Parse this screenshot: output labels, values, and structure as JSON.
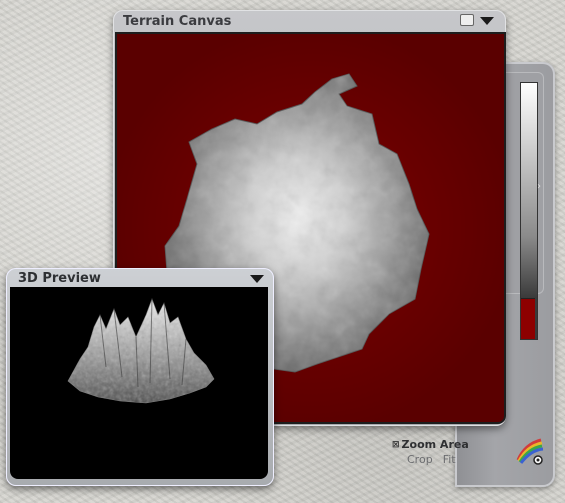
{
  "terrain_window": {
    "title": "Terrain Canvas",
    "canvas_color": "#7d0000"
  },
  "preview_window": {
    "title": "3D Preview"
  },
  "footer": {
    "zoom_label": "Zoom Area",
    "crop_label": "Crop",
    "fit_label": "Fit"
  },
  "icons": {
    "window_mode": "window-mode-icon",
    "menu": "chevron-down-icon",
    "zoom": "zoom-icon",
    "color_pen": "color-pen-icon",
    "slider_handle": "slider-handle-icon"
  },
  "colors": {
    "accent_red": "#8d0000",
    "panel_gray": "#a4a5a9"
  }
}
